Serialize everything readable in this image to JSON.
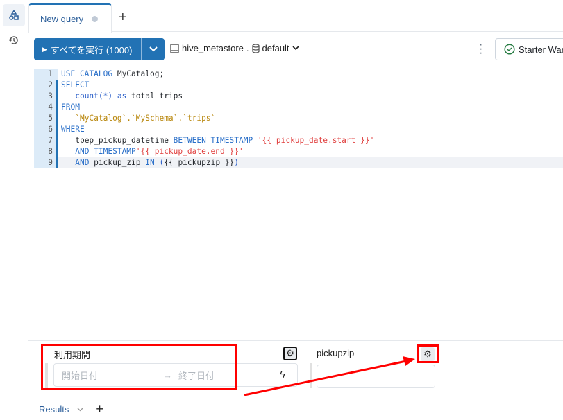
{
  "sidebar": {
    "items": [
      {
        "icon": "shapes-icon"
      },
      {
        "icon": "history-icon"
      }
    ]
  },
  "tabs": [
    {
      "label": "New query",
      "unsaved": true
    }
  ],
  "toolbar": {
    "run_label": "すべてを実行 (1000)",
    "catalog": "hive_metastore",
    "separator": ".",
    "schema": "default",
    "warehouse": "Starter War"
  },
  "editor": {
    "lines": [
      [
        [
          "kw",
          "USE CATALOG "
        ],
        [
          "id",
          "MyCatalog;"
        ]
      ],
      [
        [
          "kw",
          "SELECT"
        ]
      ],
      [
        [
          "pl",
          "   "
        ],
        [
          "fn",
          "count(*) as "
        ],
        [
          "id",
          "total_trips"
        ]
      ],
      [
        [
          "kw",
          "FROM"
        ]
      ],
      [
        [
          "pl",
          "   "
        ],
        [
          "bt",
          "`MyCatalog`.`MySchema`.`trips`"
        ]
      ],
      [
        [
          "kw",
          "WHERE"
        ]
      ],
      [
        [
          "pl",
          "   "
        ],
        [
          "id",
          "tpep_pickup_datetime "
        ],
        [
          "kw",
          "BETWEEN TIMESTAMP "
        ],
        [
          "str",
          "'{{ pickup_date.start }}'"
        ]
      ],
      [
        [
          "pl",
          "   "
        ],
        [
          "kw",
          "AND TIMESTAMP"
        ],
        [
          "str",
          "'{{ pickup_date.end }}'"
        ]
      ],
      [
        [
          "pl",
          "   "
        ],
        [
          "kw",
          "AND "
        ],
        [
          "id",
          "pickup_zip "
        ],
        [
          "kw",
          "IN "
        ],
        [
          "fn",
          "("
        ],
        [
          "id",
          "{{ pickupzip }}"
        ],
        [
          "fn",
          ")"
        ]
      ]
    ]
  },
  "params": [
    {
      "label": "利用期間",
      "start_placeholder": "開始日付",
      "arrow": "→",
      "end_placeholder": "終了日付"
    },
    {
      "label": "pickupzip",
      "value": ""
    }
  ],
  "results": {
    "label": "Results"
  },
  "colors": {
    "accent": "#2272b4",
    "annotation": "#ff0000"
  }
}
